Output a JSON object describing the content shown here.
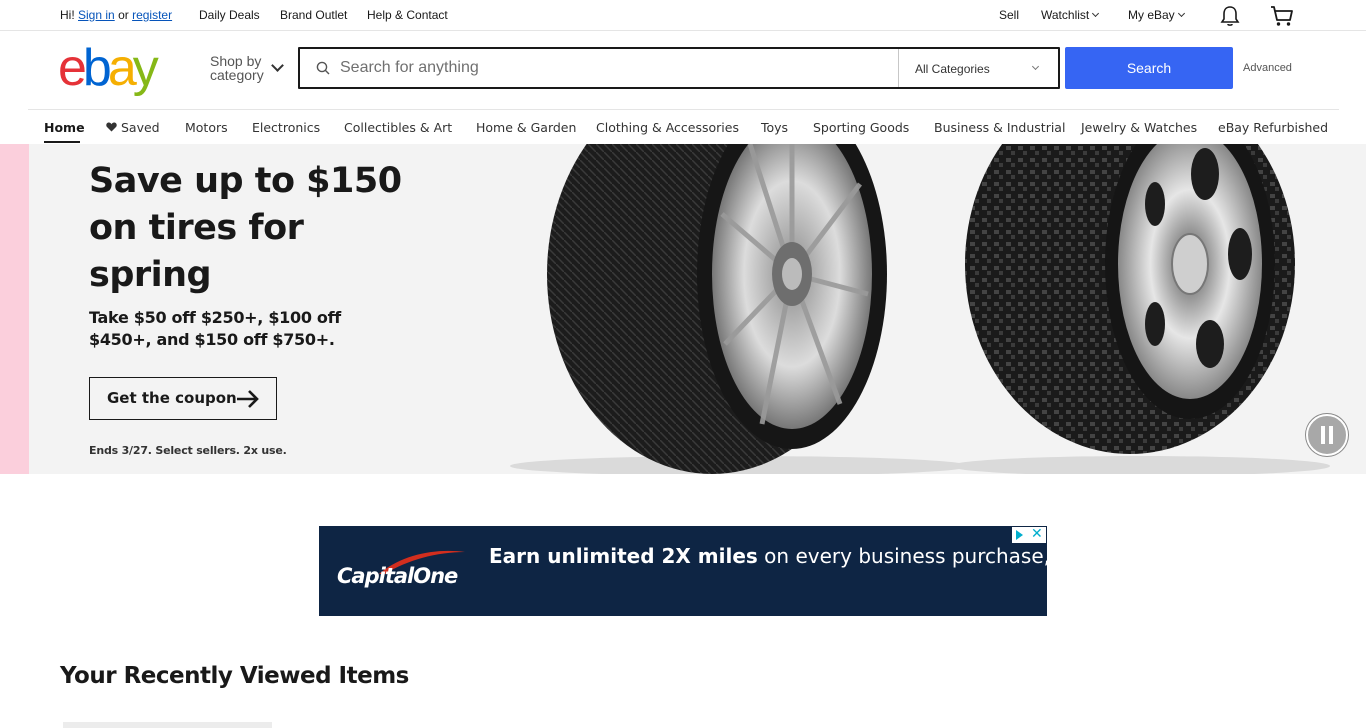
{
  "topbar": {
    "greeting": "Hi!",
    "sign_in": "Sign in",
    "or": "or",
    "register": "register",
    "daily_deals": "Daily Deals",
    "brand_outlet": "Brand Outlet",
    "help": "Help & Contact",
    "sell": "Sell",
    "watchlist": "Watchlist",
    "my_ebay": "My eBay",
    "icons": [
      "bell-icon",
      "cart-icon"
    ]
  },
  "header": {
    "logo": {
      "e": "e",
      "b": "b",
      "a": "a",
      "y": "y"
    },
    "shop_by_line1": "Shop by",
    "shop_by_line2": "category",
    "search_placeholder": "Search for anything",
    "category": "All Categories",
    "search_button": "Search",
    "advanced": "Advanced"
  },
  "nav": {
    "items": [
      "Home",
      "Saved",
      "Motors",
      "Electronics",
      "Collectibles & Art",
      "Home & Garden",
      "Clothing & Accessories",
      "Toys",
      "Sporting Goods",
      "Business & Industrial",
      "Jewelry & Watches",
      "eBay Refurbished"
    ],
    "saved_icon": "heart-icon"
  },
  "hero": {
    "title": "Save up to $150 on tires for spring",
    "subtitle": "Take $50 off $250+, $100 off $450+, and $150 off $750+.",
    "cta": "Get the coupon",
    "fine_print": "Ends 3/27. Select sellers. 2x use."
  },
  "ad": {
    "brand": "CapitalOne",
    "message_bold": "Earn unlimited 2X miles",
    "message_rest": " on every business purchase,"
  },
  "recent": {
    "title": "Your Recently Viewed Items"
  },
  "colors": {
    "accent": "#3665f3",
    "link": "#0654ba",
    "hero_bg": "#f3f3f3",
    "hero_side": "#fbcfdc",
    "ad_bg": "#0e2544"
  }
}
